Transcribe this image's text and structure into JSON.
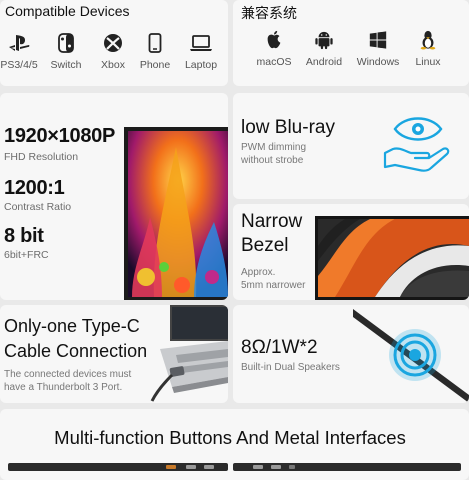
{
  "compatible": {
    "title": "Compatible Devices",
    "devices": [
      {
        "label": "PS3/4/5",
        "icon": "playstation-icon"
      },
      {
        "label": "Switch",
        "icon": "nintendo-switch-icon"
      },
      {
        "label": "Xbox",
        "icon": "xbox-icon"
      },
      {
        "label": "Phone",
        "icon": "phone-icon"
      },
      {
        "label": "Laptop",
        "icon": "laptop-icon"
      }
    ]
  },
  "systems": {
    "title": "兼容系统",
    "items": [
      {
        "label": "macOS",
        "icon": "apple-icon"
      },
      {
        "label": "Android",
        "icon": "android-icon"
      },
      {
        "label": "Windows",
        "icon": "windows-icon"
      },
      {
        "label": "Linux",
        "icon": "linux-icon"
      }
    ]
  },
  "specs": {
    "resolution": "1920×1080P",
    "resolution_sub": "FHD Resolution",
    "contrast": "1200:1",
    "contrast_sub": "Contrast Ratio",
    "bit": "8 bit",
    "bit_sub": "6bit+FRC"
  },
  "bluray": {
    "title": "low Blu-ray",
    "sub1": "PWM dimming",
    "sub2": "without strobe"
  },
  "bezel": {
    "title1": "Narrow",
    "title2": "Bezel",
    "sub1": "Approx.",
    "sub2": "5mm narrower"
  },
  "typec": {
    "title1": "Only-one Type-C",
    "title2": "Cable Connection",
    "sub1": "The connected devices must",
    "sub2": "have a Thunderbolt 3 Port."
  },
  "speaker": {
    "title": "8Ω/1W*2",
    "sub": "Built-in Dual Speakers"
  },
  "buttons": {
    "title": "Multi-function Buttons And Metal Interfaces"
  },
  "colors": {
    "accent_blue": "#1aa6e0",
    "background": "#e9e9e9",
    "card": "#f7f7f7"
  }
}
